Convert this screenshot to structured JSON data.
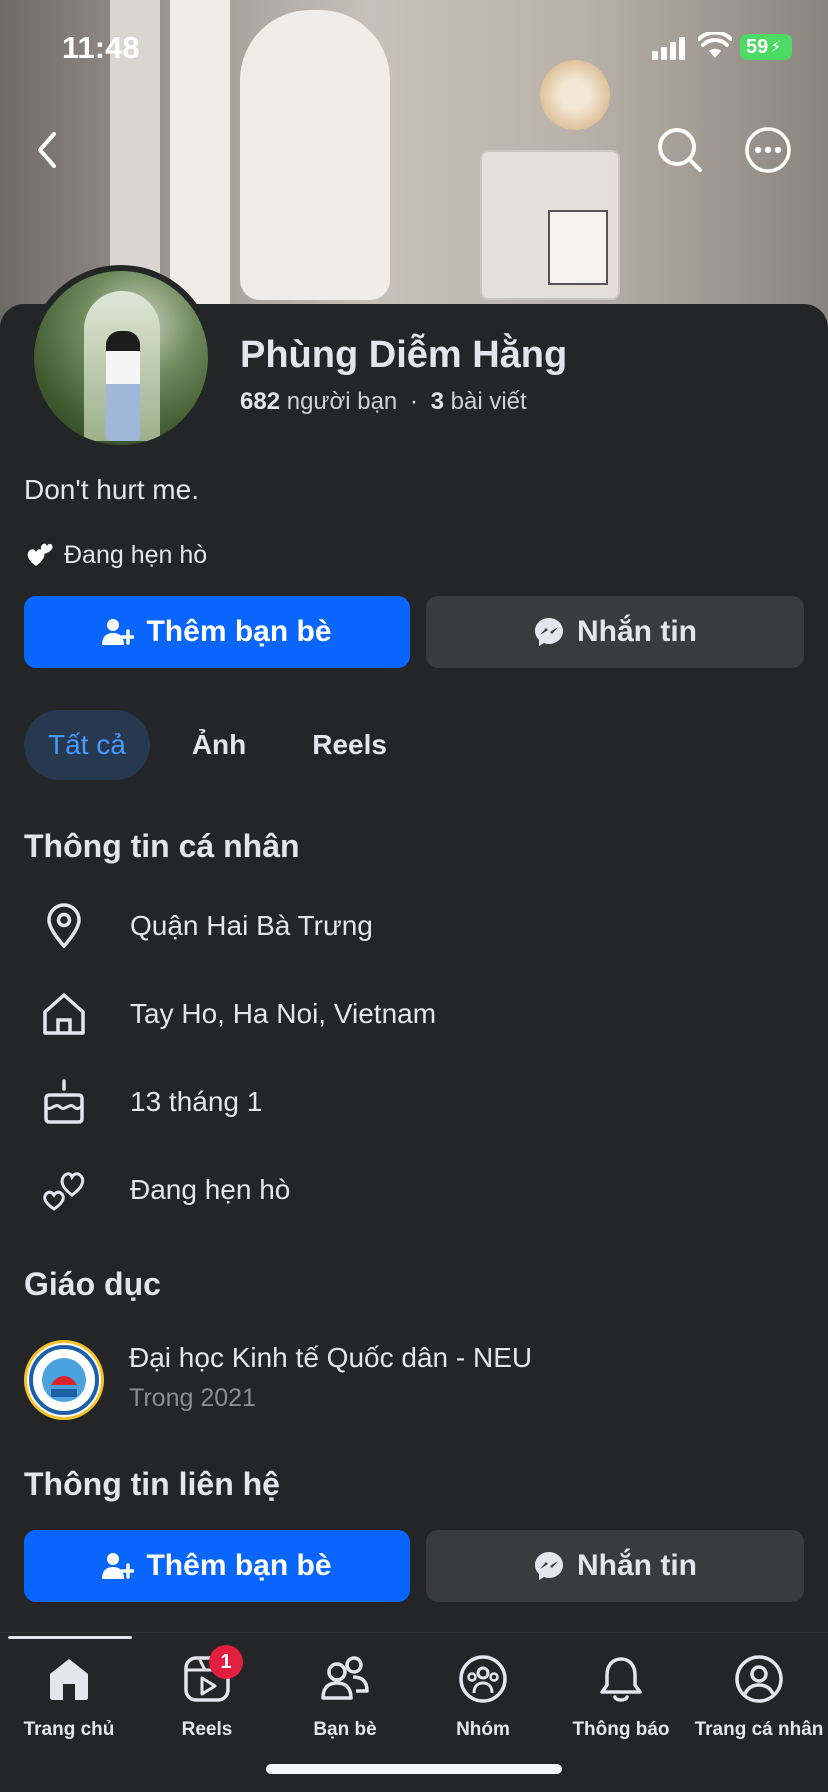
{
  "status_bar": {
    "time": "11:48",
    "battery": "59"
  },
  "profile": {
    "name": "Phùng Diễm Hằng",
    "friends_count": "682",
    "friends_label": "người bạn",
    "separator": "·",
    "posts_count": "3",
    "posts_label": "bài viết",
    "bio": "Don't hurt me.",
    "relationship": "Đang hẹn hò"
  },
  "actions": {
    "add_friend": "Thêm bạn bè",
    "message": "Nhắn tin"
  },
  "tabs": [
    {
      "label": "Tất cả",
      "active": true
    },
    {
      "label": "Ảnh",
      "active": false
    },
    {
      "label": "Reels",
      "active": false
    }
  ],
  "personal_info": {
    "title": "Thông tin cá nhân",
    "items": [
      {
        "icon": "location-pin-icon",
        "text": "Quận Hai Bà Trưng"
      },
      {
        "icon": "home-icon",
        "text": "Tay Ho, Ha Noi, Vietnam"
      },
      {
        "icon": "birthday-cake-icon",
        "text": "13 tháng 1"
      },
      {
        "icon": "hearts-icon",
        "text": "Đang hẹn hò"
      }
    ]
  },
  "education": {
    "title": "Giáo dục",
    "school": "Đại học Kinh tế Quốc dân - NEU",
    "year": "Trong 2021"
  },
  "contact": {
    "title": "Thông tin liên hệ"
  },
  "bottom_nav": [
    {
      "label": "Trang chủ",
      "icon": "home-icon",
      "active": true
    },
    {
      "label": "Reels",
      "icon": "reels-icon",
      "badge": "1"
    },
    {
      "label": "Bạn bè",
      "icon": "friends-icon"
    },
    {
      "label": "Nhóm",
      "icon": "groups-icon"
    },
    {
      "label": "Thông báo",
      "icon": "bell-icon"
    },
    {
      "label": "Trang cá nhân",
      "icon": "profile-icon"
    }
  ],
  "colors": {
    "accent": "#0866ff",
    "background": "#242526",
    "button_secondary": "#3a3b3c",
    "tab_active_bg": "#263951",
    "tab_active_text": "#4599ff",
    "badge": "#e41e3f"
  }
}
